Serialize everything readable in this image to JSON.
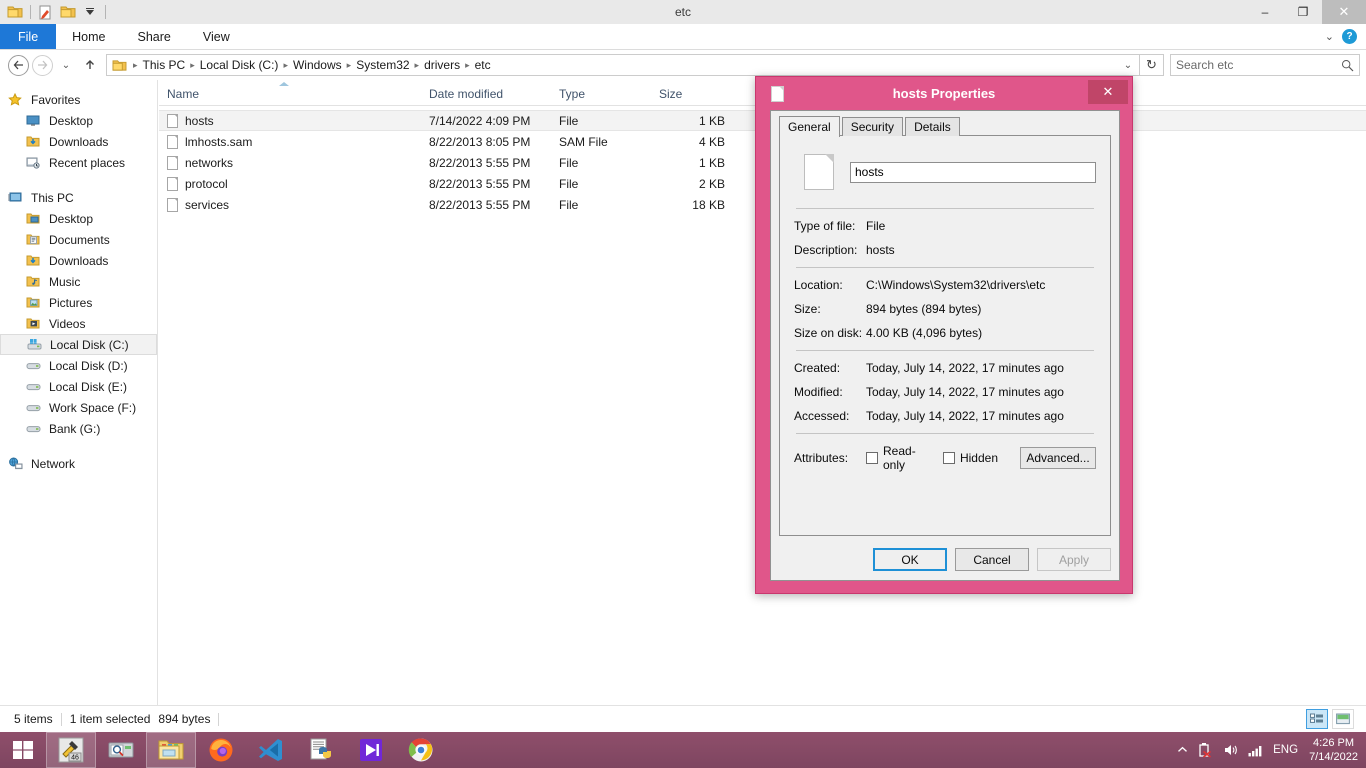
{
  "window": {
    "title": "etc",
    "quick_access": [
      "folder-icon",
      "properties-icon",
      "new-folder-icon",
      "customize-dropdown-icon"
    ],
    "minimize_label": "–",
    "restore_label": "❐",
    "close_label": "✕"
  },
  "ribbon": {
    "tabs": [
      {
        "label": "File",
        "active_file": true
      },
      {
        "label": "Home",
        "active_file": false
      },
      {
        "label": "Share",
        "active_file": false
      },
      {
        "label": "View",
        "active_file": false
      }
    ],
    "collapse_label": "⌄",
    "help_label": "?"
  },
  "address": {
    "back_label": "←",
    "forward_label": "→",
    "recent_label": "⌄",
    "up_label": "↑",
    "crumbs": [
      "This PC",
      "Local Disk (C:)",
      "Windows",
      "System32",
      "drivers",
      "etc"
    ],
    "separator": "▸",
    "dropdown_label": "⌄",
    "refresh_label": "↻"
  },
  "search": {
    "placeholder": "Search etc",
    "value": "",
    "icon": "search-icon"
  },
  "sidebar": {
    "groups": [
      {
        "header": {
          "label": "Favorites",
          "icon": "star-icon"
        },
        "items": [
          {
            "label": "Desktop",
            "icon": "desktop-icon",
            "selected": false
          },
          {
            "label": "Downloads",
            "icon": "downloads-icon",
            "selected": false
          },
          {
            "label": "Recent places",
            "icon": "recent-places-icon",
            "selected": false
          }
        ]
      },
      {
        "header": {
          "label": "This PC",
          "icon": "computer-icon"
        },
        "items": [
          {
            "label": "Desktop",
            "icon": "desktop-folder-icon",
            "selected": false
          },
          {
            "label": "Documents",
            "icon": "documents-icon",
            "selected": false
          },
          {
            "label": "Downloads",
            "icon": "downloads-icon",
            "selected": false
          },
          {
            "label": "Music",
            "icon": "music-icon",
            "selected": false
          },
          {
            "label": "Pictures",
            "icon": "pictures-icon",
            "selected": false
          },
          {
            "label": "Videos",
            "icon": "videos-icon",
            "selected": false
          },
          {
            "label": "Local Disk (C:)",
            "icon": "system-drive-icon",
            "selected": true
          },
          {
            "label": "Local Disk (D:)",
            "icon": "drive-icon",
            "selected": false
          },
          {
            "label": "Local Disk (E:)",
            "icon": "drive-icon",
            "selected": false
          },
          {
            "label": "Work Space (F:)",
            "icon": "drive-icon",
            "selected": false
          },
          {
            "label": "Bank (G:)",
            "icon": "drive-icon",
            "selected": false
          }
        ]
      },
      {
        "header": {
          "label": "Network",
          "icon": "network-icon"
        },
        "items": []
      }
    ]
  },
  "filelist": {
    "columns": [
      {
        "label": "Name",
        "key": "name",
        "sorted": "asc"
      },
      {
        "label": "Date modified",
        "key": "date",
        "sorted": ""
      },
      {
        "label": "Type",
        "key": "type",
        "sorted": ""
      },
      {
        "label": "Size",
        "key": "size",
        "sorted": ""
      }
    ],
    "rows": [
      {
        "name": "hosts",
        "date": "7/14/2022 4:09 PM",
        "type": "File",
        "size": "1 KB",
        "selected": true
      },
      {
        "name": "lmhosts.sam",
        "date": "8/22/2013 8:05 PM",
        "type": "SAM File",
        "size": "4 KB",
        "selected": false
      },
      {
        "name": "networks",
        "date": "8/22/2013 5:55 PM",
        "type": "File",
        "size": "1 KB",
        "selected": false
      },
      {
        "name": "protocol",
        "date": "8/22/2013 5:55 PM",
        "type": "File",
        "size": "2 KB",
        "selected": false
      },
      {
        "name": "services",
        "date": "8/22/2013 5:55 PM",
        "type": "File",
        "size": "18 KB",
        "selected": false
      }
    ]
  },
  "statusbar": {
    "items_count": "5 items",
    "selection": "1 item selected",
    "selection_size": "894 bytes",
    "view_details": "details-view-icon",
    "view_large": "large-icons-view-icon"
  },
  "dialog": {
    "title": "hosts Properties",
    "close_label": "✕",
    "accent_color": "#e0568a",
    "tabs": [
      {
        "label": "General",
        "active": true
      },
      {
        "label": "Security",
        "active": false
      },
      {
        "label": "Details",
        "active": false
      }
    ],
    "filename_value": "hosts",
    "fields": [
      {
        "label": "Type of file:",
        "value": "File"
      },
      {
        "label": "Description:",
        "value": "hosts"
      }
    ],
    "location_fields": [
      {
        "label": "Location:",
        "value": "C:\\Windows\\System32\\drivers\\etc"
      },
      {
        "label": "Size:",
        "value": "894 bytes (894 bytes)"
      },
      {
        "label": "Size on disk:",
        "value": "4.00 KB (4,096 bytes)"
      }
    ],
    "time_fields": [
      {
        "label": "Created:",
        "value": "Today, July 14, 2022, 17 minutes ago"
      },
      {
        "label": "Modified:",
        "value": "Today, July 14, 2022, 17 minutes ago"
      },
      {
        "label": "Accessed:",
        "value": "Today, July 14, 2022, 17 minutes ago"
      }
    ],
    "attributes": {
      "label": "Attributes:",
      "readonly": {
        "label": "Read-only",
        "checked": false
      },
      "hidden": {
        "label": "Hidden",
        "checked": false
      },
      "advanced": "Advanced..."
    },
    "buttons": [
      {
        "label": "OK",
        "style": "primary"
      },
      {
        "label": "Cancel",
        "style": "normal"
      },
      {
        "label": "Apply",
        "style": "disabled"
      }
    ]
  },
  "taskbar": {
    "start": "windows-start-icon",
    "items": [
      {
        "icon": "hammer-tool-icon",
        "badge": "46",
        "active": true
      },
      {
        "icon": "magnifier-tool-icon",
        "active": false
      },
      {
        "icon": "file-explorer-icon",
        "active": true
      },
      {
        "icon": "firefox-icon",
        "active": false
      },
      {
        "icon": "vscode-icon",
        "active": false
      },
      {
        "icon": "python-script-icon",
        "active": false
      },
      {
        "icon": "media-player-icon",
        "active": false
      },
      {
        "icon": "chrome-icon",
        "active": false
      }
    ],
    "tray": {
      "expand": "show-hidden-icons-chevron",
      "battery": "battery-error-icon",
      "volume": "volume-icon",
      "network": "signal-bars-icon",
      "language": "ENG",
      "time": "4:26 PM",
      "date": "7/14/2022"
    }
  }
}
